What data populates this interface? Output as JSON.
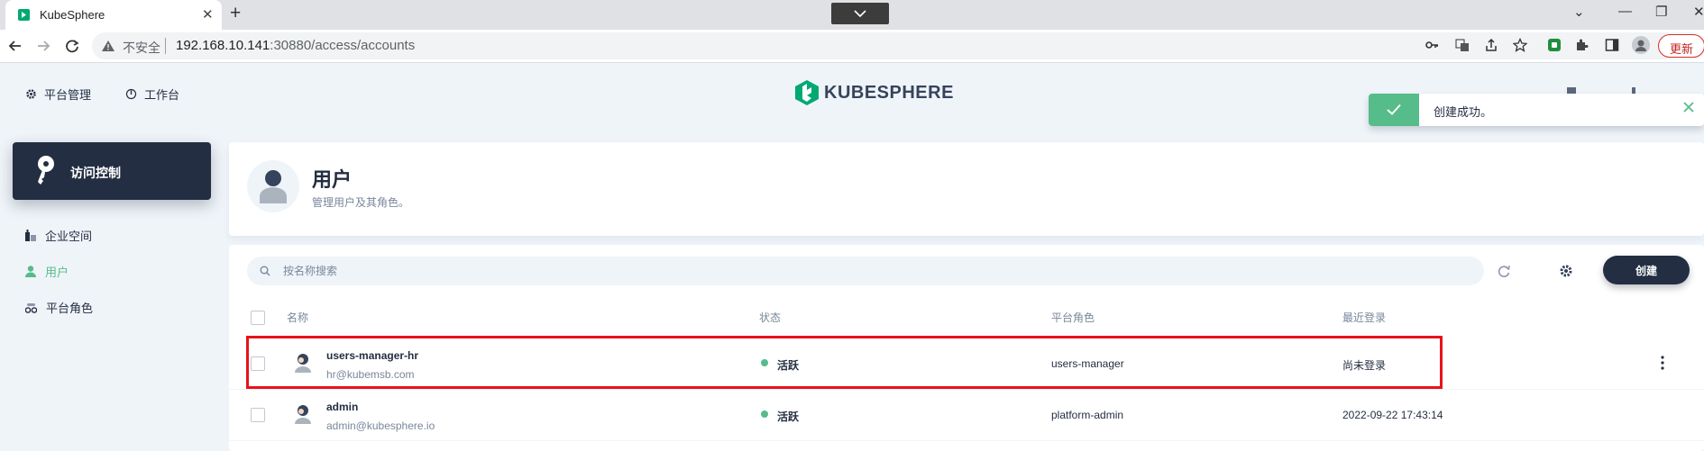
{
  "browser": {
    "tab_title": "KubeSphere",
    "address": {
      "insecure_label": "不安全",
      "host": "192.168.10.141",
      "rest": ":30880/access/accounts"
    },
    "update_label": "更新"
  },
  "topnav": {
    "platform_label": "平台管理",
    "workbench_label": "工作台",
    "logo_text": "KUBESPHERE"
  },
  "toast": {
    "message": "创建成功。"
  },
  "sidebar": {
    "title": "访问控制",
    "items": [
      {
        "label": "企业空间",
        "icon": "enterprise-icon",
        "active": false
      },
      {
        "label": "用户",
        "icon": "user-icon",
        "active": true
      },
      {
        "label": "平台角色",
        "icon": "role-icon",
        "active": false
      }
    ]
  },
  "header": {
    "title": "用户",
    "description": "管理用户及其角色。"
  },
  "toolbar": {
    "search_placeholder": "按名称搜索",
    "create_label": "创建"
  },
  "table": {
    "columns": {
      "name": "名称",
      "status": "状态",
      "role": "平台角色",
      "last_login": "最近登录"
    },
    "rows": [
      {
        "name": "users-manager-hr",
        "email": "hr@kubemsb.com",
        "status": "活跃",
        "role": "users-manager",
        "last_login": "尚未登录"
      },
      {
        "name": "admin",
        "email": "admin@kubesphere.io",
        "status": "活跃",
        "role": "platform-admin",
        "last_login": "2022-09-22 17:43:14"
      }
    ]
  },
  "colors": {
    "accent": "#55bc8a",
    "dark": "#242e42",
    "highlight": "#e8121a"
  }
}
